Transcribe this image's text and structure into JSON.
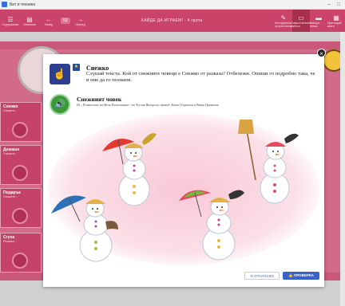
{
  "window": {
    "title": "Бит и техника"
  },
  "toolbar": {
    "left_buttons": [
      {
        "label": "Съдържание",
        "icon": "list-icon"
      },
      {
        "label": "Описание",
        "icon": "document-icon"
      },
      {
        "label": "Назад",
        "icon": "arrow-left-icon"
      },
      {
        "label": "Напред",
        "icon": "arrow-right-icon"
      }
    ],
    "page_number": "53",
    "center_title": "ХАЙДЕ ДА ИГРАЕМ! · 4 група",
    "right_buttons": [
      {
        "label": "Инструменти за учителите",
        "icon": "tools-icon"
      },
      {
        "label": "Самостоятелна работа",
        "icon": "screen-icon"
      },
      {
        "label": "Отвори папка",
        "icon": "folder-icon"
      },
      {
        "label": "Прегледай книга",
        "icon": "book-icon"
      }
    ]
  },
  "sidebar": {
    "cards": [
      {
        "label": "Снежко",
        "sub": "Опишете..."
      },
      {
        "label": "Домашн",
        "sub": "Опишете..."
      },
      {
        "label": "Подарък",
        "sub": "Опишете..."
      },
      {
        "label": "Сгуха",
        "sub": "Разкажи..."
      }
    ]
  },
  "dialog": {
    "close_label": "×",
    "task_title": "Снежко",
    "task_text": "Слушай текста. Кой от снежните човеци е Снежко от разказа? Отбележи. Опиши го подробно така, че и ние да го познаем.",
    "story_title": "Снежният човек",
    "story_credit": "Из „Потеклото на Меча Кленотинка“ от Чеслав Янчарски, превод: Катя Георгиева и Райна Цветкова",
    "restart_label": "⟲ ОТНАЧАЛО",
    "check_label": "👍 ПРОВЕРКА"
  },
  "colors": {
    "toolbar": "#c94468",
    "book": "#c9587a",
    "accent_button": "#3a63c7"
  }
}
